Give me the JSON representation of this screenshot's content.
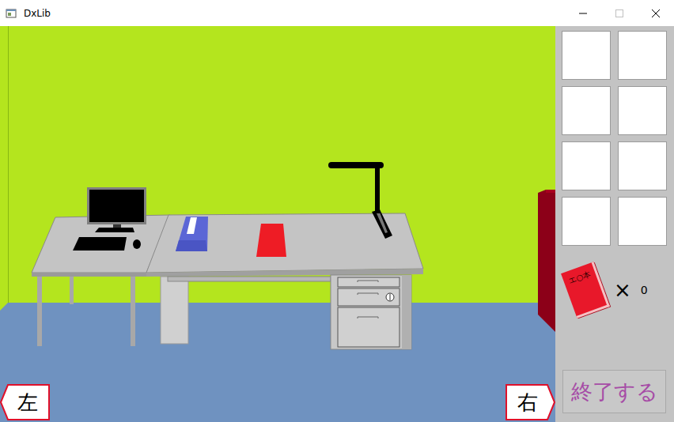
{
  "window": {
    "title": "DxLib"
  },
  "scene": {
    "nav": [
      {
        "label": "左",
        "kind": "left"
      },
      {
        "label": "右",
        "kind": "right"
      }
    ]
  },
  "inventory": {
    "slots": [
      {
        "empty": true
      },
      {
        "empty": true
      },
      {
        "empty": true
      },
      {
        "empty": true
      },
      {
        "empty": true
      },
      {
        "empty": true
      },
      {
        "empty": true
      },
      {
        "empty": true
      }
    ]
  },
  "item": {
    "label": "エ○本",
    "times": "×",
    "count": "0"
  },
  "quit_button": {
    "label": "終了する"
  }
}
